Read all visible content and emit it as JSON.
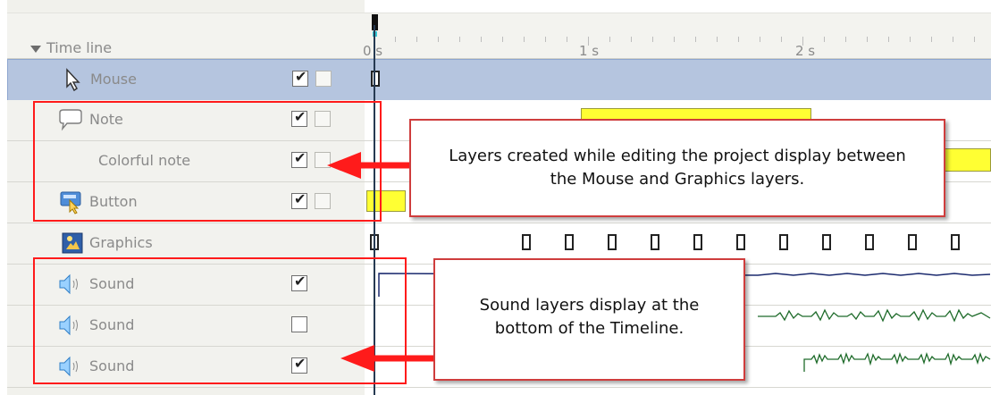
{
  "header": {
    "title": "Time line",
    "ticks": [
      "0 s",
      "1 s",
      "2 s"
    ]
  },
  "rows": [
    {
      "label": "Mouse",
      "icon": "mouse-icon",
      "checked": true
    },
    {
      "label": "Note",
      "icon": "note-icon",
      "checked": true
    },
    {
      "label": "Colorful note",
      "icon": "",
      "checked": true
    },
    {
      "label": "Button",
      "icon": "button-icon",
      "checked": true
    },
    {
      "label": "Graphics",
      "icon": "graphics-icon",
      "checked": false
    },
    {
      "label": "Sound",
      "icon": "sound-icon",
      "checked": true
    },
    {
      "label": "Sound",
      "icon": "sound-icon",
      "checked": false
    },
    {
      "label": "Sound",
      "icon": "sound-icon",
      "checked": true
    }
  ],
  "callouts": {
    "layers": "Layers created while editing the project display between the Mouse and Graphics layers.",
    "sound": "Sound layers display at the bottom of the Timeline."
  },
  "colors": {
    "selected_row": "#b5c5df",
    "callout_border": "#ff1b1b",
    "note_block": "#ffff33"
  }
}
